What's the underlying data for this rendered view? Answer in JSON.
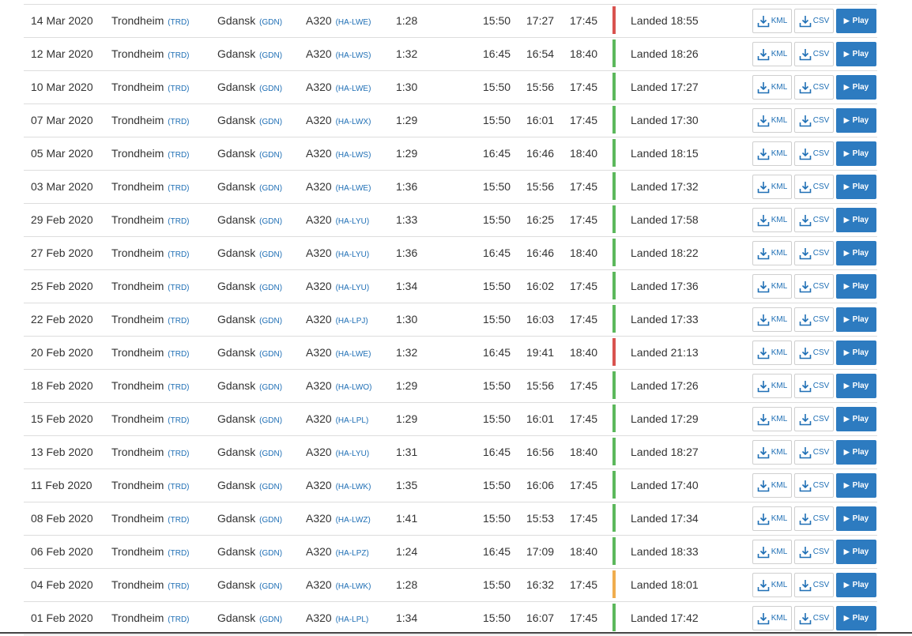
{
  "colors": {
    "on_time": "#5cb85c",
    "late": "#d9534f",
    "delayed": "#f0ad4e",
    "link": "#1f6fb5",
    "play": "#2d7bc0"
  },
  "buttons": {
    "kml_label": "KML",
    "csv_label": "CSV",
    "play_label": "Play"
  },
  "icons": {
    "download": "download-icon",
    "play": "play-icon"
  },
  "flights": [
    {
      "date": "14 Mar 2020",
      "from": "Trondheim",
      "from_code": "(TRD)",
      "to": "Gdansk",
      "to_code": "(GDN)",
      "aircraft": "A320",
      "reg": "(HA-LWE)",
      "duration": "1:28",
      "std": "15:50",
      "atd": "17:27",
      "sta": "17:45",
      "status_color": "late",
      "status": "Landed 18:55"
    },
    {
      "date": "12 Mar 2020",
      "from": "Trondheim",
      "from_code": "(TRD)",
      "to": "Gdansk",
      "to_code": "(GDN)",
      "aircraft": "A320",
      "reg": "(HA-LWS)",
      "duration": "1:32",
      "std": "16:45",
      "atd": "16:54",
      "sta": "18:40",
      "status_color": "on_time",
      "status": "Landed 18:26"
    },
    {
      "date": "10 Mar 2020",
      "from": "Trondheim",
      "from_code": "(TRD)",
      "to": "Gdansk",
      "to_code": "(GDN)",
      "aircraft": "A320",
      "reg": "(HA-LWE)",
      "duration": "1:30",
      "std": "15:50",
      "atd": "15:56",
      "sta": "17:45",
      "status_color": "on_time",
      "status": "Landed 17:27"
    },
    {
      "date": "07 Mar 2020",
      "from": "Trondheim",
      "from_code": "(TRD)",
      "to": "Gdansk",
      "to_code": "(GDN)",
      "aircraft": "A320",
      "reg": "(HA-LWX)",
      "duration": "1:29",
      "std": "15:50",
      "atd": "16:01",
      "sta": "17:45",
      "status_color": "on_time",
      "status": "Landed 17:30"
    },
    {
      "date": "05 Mar 2020",
      "from": "Trondheim",
      "from_code": "(TRD)",
      "to": "Gdansk",
      "to_code": "(GDN)",
      "aircraft": "A320",
      "reg": "(HA-LWS)",
      "duration": "1:29",
      "std": "16:45",
      "atd": "16:46",
      "sta": "18:40",
      "status_color": "on_time",
      "status": "Landed 18:15"
    },
    {
      "date": "03 Mar 2020",
      "from": "Trondheim",
      "from_code": "(TRD)",
      "to": "Gdansk",
      "to_code": "(GDN)",
      "aircraft": "A320",
      "reg": "(HA-LWE)",
      "duration": "1:36",
      "std": "15:50",
      "atd": "15:56",
      "sta": "17:45",
      "status_color": "on_time",
      "status": "Landed 17:32"
    },
    {
      "date": "29 Feb 2020",
      "from": "Trondheim",
      "from_code": "(TRD)",
      "to": "Gdansk",
      "to_code": "(GDN)",
      "aircraft": "A320",
      "reg": "(HA-LYU)",
      "duration": "1:33",
      "std": "15:50",
      "atd": "16:25",
      "sta": "17:45",
      "status_color": "on_time",
      "status": "Landed 17:58"
    },
    {
      "date": "27 Feb 2020",
      "from": "Trondheim",
      "from_code": "(TRD)",
      "to": "Gdansk",
      "to_code": "(GDN)",
      "aircraft": "A320",
      "reg": "(HA-LYU)",
      "duration": "1:36",
      "std": "16:45",
      "atd": "16:46",
      "sta": "18:40",
      "status_color": "on_time",
      "status": "Landed 18:22"
    },
    {
      "date": "25 Feb 2020",
      "from": "Trondheim",
      "from_code": "(TRD)",
      "to": "Gdansk",
      "to_code": "(GDN)",
      "aircraft": "A320",
      "reg": "(HA-LYU)",
      "duration": "1:34",
      "std": "15:50",
      "atd": "16:02",
      "sta": "17:45",
      "status_color": "on_time",
      "status": "Landed 17:36"
    },
    {
      "date": "22 Feb 2020",
      "from": "Trondheim",
      "from_code": "(TRD)",
      "to": "Gdansk",
      "to_code": "(GDN)",
      "aircraft": "A320",
      "reg": "(HA-LPJ)",
      "duration": "1:30",
      "std": "15:50",
      "atd": "16:03",
      "sta": "17:45",
      "status_color": "on_time",
      "status": "Landed 17:33"
    },
    {
      "date": "20 Feb 2020",
      "from": "Trondheim",
      "from_code": "(TRD)",
      "to": "Gdansk",
      "to_code": "(GDN)",
      "aircraft": "A320",
      "reg": "(HA-LWE)",
      "duration": "1:32",
      "std": "16:45",
      "atd": "19:41",
      "sta": "18:40",
      "status_color": "late",
      "status": "Landed 21:13"
    },
    {
      "date": "18 Feb 2020",
      "from": "Trondheim",
      "from_code": "(TRD)",
      "to": "Gdansk",
      "to_code": "(GDN)",
      "aircraft": "A320",
      "reg": "(HA-LWO)",
      "duration": "1:29",
      "std": "15:50",
      "atd": "15:56",
      "sta": "17:45",
      "status_color": "on_time",
      "status": "Landed 17:26"
    },
    {
      "date": "15 Feb 2020",
      "from": "Trondheim",
      "from_code": "(TRD)",
      "to": "Gdansk",
      "to_code": "(GDN)",
      "aircraft": "A320",
      "reg": "(HA-LPL)",
      "duration": "1:29",
      "std": "15:50",
      "atd": "16:01",
      "sta": "17:45",
      "status_color": "on_time",
      "status": "Landed 17:29"
    },
    {
      "date": "13 Feb 2020",
      "from": "Trondheim",
      "from_code": "(TRD)",
      "to": "Gdansk",
      "to_code": "(GDN)",
      "aircraft": "A320",
      "reg": "(HA-LYU)",
      "duration": "1:31",
      "std": "16:45",
      "atd": "16:56",
      "sta": "18:40",
      "status_color": "on_time",
      "status": "Landed 18:27"
    },
    {
      "date": "11 Feb 2020",
      "from": "Trondheim",
      "from_code": "(TRD)",
      "to": "Gdansk",
      "to_code": "(GDN)",
      "aircraft": "A320",
      "reg": "(HA-LWK)",
      "duration": "1:35",
      "std": "15:50",
      "atd": "16:06",
      "sta": "17:45",
      "status_color": "on_time",
      "status": "Landed 17:40"
    },
    {
      "date": "08 Feb 2020",
      "from": "Trondheim",
      "from_code": "(TRD)",
      "to": "Gdansk",
      "to_code": "(GDN)",
      "aircraft": "A320",
      "reg": "(HA-LWZ)",
      "duration": "1:41",
      "std": "15:50",
      "atd": "15:53",
      "sta": "17:45",
      "status_color": "on_time",
      "status": "Landed 17:34"
    },
    {
      "date": "06 Feb 2020",
      "from": "Trondheim",
      "from_code": "(TRD)",
      "to": "Gdansk",
      "to_code": "(GDN)",
      "aircraft": "A320",
      "reg": "(HA-LPZ)",
      "duration": "1:24",
      "std": "16:45",
      "atd": "17:09",
      "sta": "18:40",
      "status_color": "on_time",
      "status": "Landed 18:33"
    },
    {
      "date": "04 Feb 2020",
      "from": "Trondheim",
      "from_code": "(TRD)",
      "to": "Gdansk",
      "to_code": "(GDN)",
      "aircraft": "A320",
      "reg": "(HA-LWK)",
      "duration": "1:28",
      "std": "15:50",
      "atd": "16:32",
      "sta": "17:45",
      "status_color": "delayed",
      "status": "Landed 18:01"
    },
    {
      "date": "01 Feb 2020",
      "from": "Trondheim",
      "from_code": "(TRD)",
      "to": "Gdansk",
      "to_code": "(GDN)",
      "aircraft": "A320",
      "reg": "(HA-LPL)",
      "duration": "1:34",
      "std": "15:50",
      "atd": "16:07",
      "sta": "17:45",
      "status_color": "on_time",
      "status": "Landed 17:42"
    }
  ]
}
